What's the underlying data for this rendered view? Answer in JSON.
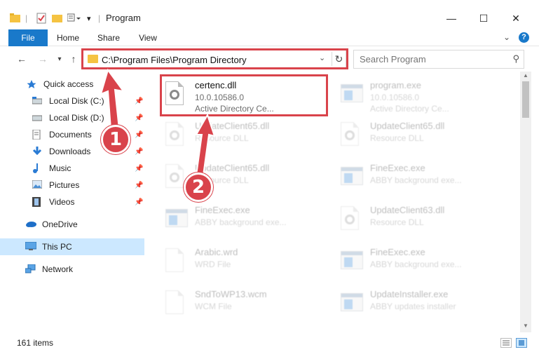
{
  "window": {
    "title": "Program",
    "minimize": "—",
    "maximize": "☐",
    "close": "✕",
    "help": "?",
    "expand": "⌄"
  },
  "ribbon": {
    "tabs": [
      {
        "label": "File"
      },
      {
        "label": "Home"
      },
      {
        "label": "Share"
      },
      {
        "label": "View"
      }
    ]
  },
  "address": {
    "path": "C:\\Program Files\\Program Directory",
    "search_placeholder": "Search Program"
  },
  "nav_pane": {
    "items": [
      {
        "label": "Quick access",
        "icon": "star-icon",
        "pinned": false
      },
      {
        "label": "Local Disk (C:)",
        "icon": "drive-icon",
        "pinned": true
      },
      {
        "label": "Local Disk (D:)",
        "icon": "drive-icon",
        "pinned": true
      },
      {
        "label": "Documents",
        "icon": "documents-icon",
        "pinned": true
      },
      {
        "label": "Downloads",
        "icon": "download-icon",
        "pinned": true
      },
      {
        "label": "Music",
        "icon": "music-icon",
        "pinned": true
      },
      {
        "label": "Pictures",
        "icon": "pictures-icon",
        "pinned": true
      },
      {
        "label": "Videos",
        "icon": "videos-icon",
        "pinned": true
      },
      {
        "label": "OneDrive",
        "icon": "cloud-icon",
        "pinned": false
      },
      {
        "label": "This PC",
        "icon": "pc-icon",
        "pinned": false,
        "selected": true
      },
      {
        "label": "Network",
        "icon": "network-icon",
        "pinned": false
      }
    ]
  },
  "files": [
    {
      "name": "certenc.dll",
      "line1": "10.0.10586.0",
      "line2": "Active Directory Ce...",
      "type": "dll",
      "highlighted": true
    },
    {
      "name": "program.exe",
      "line1": "10.0.10586.0",
      "line2": "Active Directory Ce...",
      "type": "exe"
    },
    {
      "name": "UpdateClient65.dll",
      "line1": "Resource DLL",
      "line2": "",
      "type": "dll"
    },
    {
      "name": "UpdateClient65.dll",
      "line1": "Resource DLL",
      "line2": "",
      "type": "dll"
    },
    {
      "name": "UpdateClient65.dll",
      "line1": "Resource DLL",
      "line2": "",
      "type": "dll"
    },
    {
      "name": "FineExec.exe",
      "line1": "ABBY background exe...",
      "line2": "",
      "type": "exe"
    },
    {
      "name": "FineExec.exe",
      "line1": "ABBY background exe...",
      "line2": "",
      "type": "exe"
    },
    {
      "name": "UpdateClient63.dll",
      "line1": "Resource DLL",
      "line2": "",
      "type": "dll"
    },
    {
      "name": "Arabic.wrd",
      "line1": "WRD File",
      "line2": "",
      "type": "doc"
    },
    {
      "name": "FineExec.exe",
      "line1": "ABBY background exe...",
      "line2": "",
      "type": "exe"
    },
    {
      "name": "SndToWP13.wcm",
      "line1": "WCM File",
      "line2": "",
      "type": "doc"
    },
    {
      "name": "UpdateInstaller.exe",
      "line1": "ABBY updates installer",
      "line2": "",
      "type": "exe"
    }
  ],
  "status": {
    "count": "161 items"
  },
  "callouts": {
    "one": "1",
    "two": "2"
  },
  "colors": {
    "accent": "#1979ca",
    "highlight": "#d9434b",
    "selected": "#cce8ff"
  }
}
